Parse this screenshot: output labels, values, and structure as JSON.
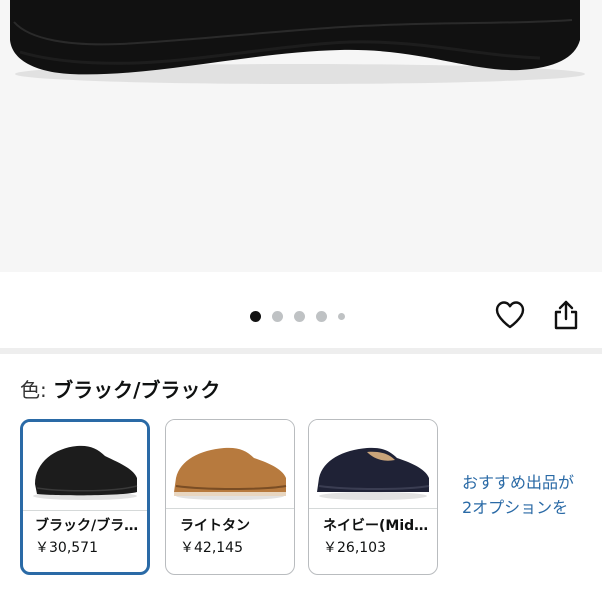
{
  "product": {
    "gallery": {
      "dot_count": 5,
      "active_index": 0
    }
  },
  "actions": {
    "favorite_icon": "heart-outline-icon",
    "share_icon": "share-icon"
  },
  "color": {
    "label": "色: ",
    "selected_value": "ブラック/ブラック"
  },
  "variants": [
    {
      "name": "ブラック/ブラック",
      "price": "￥30,571",
      "shoe_color": "#1c1c1c",
      "selected": true
    },
    {
      "name": "ライトタン",
      "price": "￥42,145",
      "shoe_color": "#b77a3e",
      "selected": false
    },
    {
      "name": "ネイビー(Midnight Navy)",
      "price": "￥26,103",
      "shoe_color": "#1f2236",
      "selected": false
    }
  ],
  "more_options": {
    "line1": "おすすめ出品が",
    "line2": "2オプションを"
  },
  "colors": {
    "link": "#2a6aa6",
    "selected_border": "#2a6aa6"
  }
}
